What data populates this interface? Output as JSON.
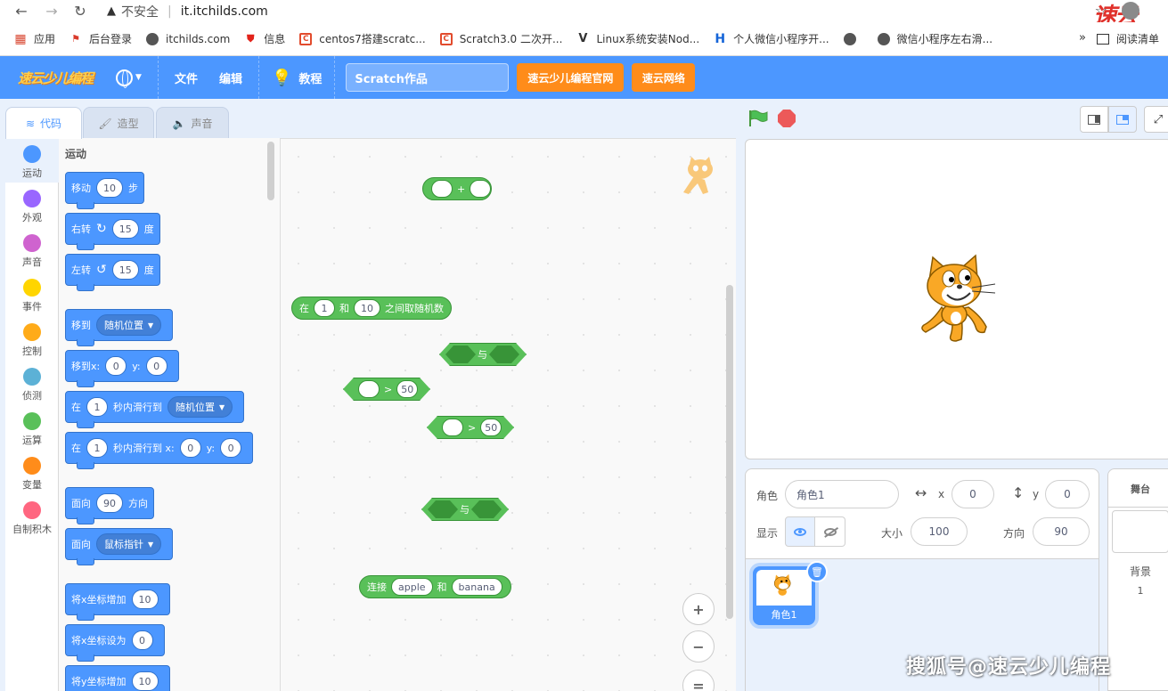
{
  "browser": {
    "security_text": "不安全",
    "url": "it.itchilds.com",
    "brand_text": "速云少儿编程",
    "bookmarks": [
      {
        "label": "应用",
        "icon": "apps-grid-icon"
      },
      {
        "label": "后台登录",
        "icon": "flag-icon"
      },
      {
        "label": "itchilds.com",
        "icon": "globe-icon"
      },
      {
        "label": "信息",
        "icon": "shield-icon"
      },
      {
        "label": "centos7搭建scratc...",
        "icon": "csdn-icon"
      },
      {
        "label": "Scratch3.0 二次开...",
        "icon": "csdn-icon"
      },
      {
        "label": "Linux系统安装Nod...",
        "icon": "v-icon"
      },
      {
        "label": "个人微信小程序开...",
        "icon": "h-icon"
      },
      {
        "label": "",
        "icon": "globe-icon"
      },
      {
        "label": "微信小程序左右滑...",
        "icon": "globe-icon"
      }
    ],
    "more": "»",
    "reading_list": "阅读清单"
  },
  "menubar": {
    "logo": "速云少儿编程",
    "file": "文件",
    "edit": "编辑",
    "tutorial": "教程",
    "project_title": "Scratch作品",
    "btn_official": "速云少儿编程官网",
    "btn_network": "速云网络"
  },
  "tabs": {
    "code": "代码",
    "costume": "造型",
    "sound": "声音"
  },
  "categories": [
    {
      "label": "运动",
      "color": "#4c97ff"
    },
    {
      "label": "外观",
      "color": "#9966ff"
    },
    {
      "label": "声音",
      "color": "#cf63cf"
    },
    {
      "label": "事件",
      "color": "#ffd500"
    },
    {
      "label": "控制",
      "color": "#ffab19"
    },
    {
      "label": "侦测",
      "color": "#5cb1d6"
    },
    {
      "label": "运算",
      "color": "#59c059"
    },
    {
      "label": "变量",
      "color": "#ff8c1a"
    },
    {
      "label": "自制积木",
      "color": "#ff6680"
    }
  ],
  "palette": {
    "title": "运动",
    "move": {
      "a": "移动",
      "n": "10",
      "b": "步"
    },
    "turn_right": {
      "a": "右转",
      "n": "15",
      "b": "度"
    },
    "turn_left": {
      "a": "左转",
      "n": "15",
      "b": "度"
    },
    "goto": {
      "a": "移到",
      "opt": "随机位置"
    },
    "goto_xy": {
      "a": "移到x:",
      "x": "0",
      "ylbl": "y:",
      "y": "0"
    },
    "glide": {
      "a": "在",
      "n": "1",
      "b": "秒内滑行到",
      "opt": "随机位置"
    },
    "glide_xy": {
      "a": "在",
      "n": "1",
      "b": "秒内滑行到 x:",
      "x": "0",
      "ylbl": "y:",
      "y": "0"
    },
    "point_dir": {
      "a": "面向",
      "n": "90",
      "b": "方向"
    },
    "point_towards": {
      "a": "面向",
      "opt": "鼠标指针"
    },
    "change_x": {
      "a": "将x坐标增加",
      "n": "10"
    },
    "set_x": {
      "a": "将x坐标设为",
      "n": "0"
    },
    "change_y": {
      "a": "将y坐标增加",
      "n": "10"
    }
  },
  "script": {
    "add": {
      "op": "+"
    },
    "random": {
      "a": "在",
      "n1": "1",
      "b": "和",
      "n2": "10",
      "c": "之间取随机数"
    },
    "and1": {
      "op": "与"
    },
    "gt1": {
      "op": ">",
      "n": "50"
    },
    "gt2": {
      "op": ">",
      "n": "50"
    },
    "and2": {
      "op": "与"
    },
    "join": {
      "a": "连接",
      "s1": "apple",
      "b": "和",
      "s2": "banana"
    },
    "zoom_in": "+",
    "zoom_out": "−",
    "zoom_reset": "="
  },
  "sprite_info": {
    "sprite_label": "角色",
    "sprite_name": "角色1",
    "x_label": "x",
    "x": "0",
    "y_label": "y",
    "y": "0",
    "show_label": "显示",
    "size_label": "大小",
    "size": "100",
    "direction_label": "方向",
    "direction": "90",
    "tile_name": "角色1"
  },
  "stage_panel": {
    "title": "舞台",
    "backdrop_label": "背景",
    "backdrop_count": "1"
  },
  "watermark": "搜狐号@速云少儿编程"
}
